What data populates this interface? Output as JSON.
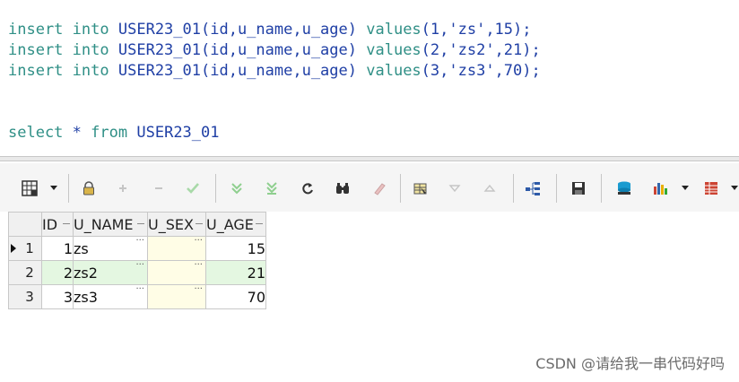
{
  "editor": {
    "lines": [
      {
        "kw1": "insert",
        "kw2": "into",
        "table": "USER23_01",
        "cols": "(id,u_name,u_age)",
        "kw3": "values",
        "vals": "(1,'zs',15);"
      },
      {
        "kw1": "insert",
        "kw2": "into",
        "table": "USER23_01",
        "cols": "(id,u_name,u_age)",
        "kw3": "values",
        "vals": "(2,'zs2',21);"
      },
      {
        "kw1": "insert",
        "kw2": "into",
        "table": "USER23_01",
        "cols": "(id,u_name,u_age)",
        "kw3": "values",
        "vals": "(3,'zs3',70);"
      }
    ],
    "select": {
      "kw1": "select",
      "star": "*",
      "kw2": "from",
      "table": "USER23_01"
    }
  },
  "toolbar": {
    "icons": [
      "grid-view-icon",
      "lock-icon",
      "add-row-icon",
      "remove-row-icon",
      "commit-icon",
      "fetch-next-icon",
      "fetch-last-icon",
      "refresh-icon",
      "find-icon",
      "clear-icon",
      "query-by-example-icon",
      "sort-descending-icon",
      "sort-ascending-icon",
      "tree-icon",
      "save-icon",
      "export-icon",
      "chart-icon",
      "table-icon"
    ]
  },
  "grid": {
    "columns": [
      "ID",
      "U_NAME",
      "U_SEX",
      "U_AGE"
    ],
    "rows": [
      {
        "n": "1",
        "id": "1",
        "name": "zs",
        "sex": "",
        "age": "15"
      },
      {
        "n": "2",
        "id": "2",
        "name": "zs2",
        "sex": "",
        "age": "21"
      },
      {
        "n": "3",
        "id": "3",
        "name": "zs3",
        "sex": "",
        "age": "70"
      }
    ],
    "ellipsis": "···"
  },
  "watermark": "CSDN @请给我一串代码好吗",
  "colors": {
    "keyword": "#2f8f86",
    "identifier": "#1f3fa5",
    "alt_row": "#e4f7e1",
    "null_cell": "#fffde6"
  }
}
